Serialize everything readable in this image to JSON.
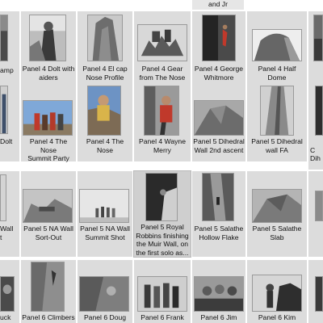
{
  "window": {
    "title": ""
  },
  "rows": [
    {
      "name": "row-1",
      "tiles": [
        {
          "id": "r1c0",
          "label": "amp"
        },
        {
          "id": "r1c1",
          "label": "Panel 4 Dolt with\naiders"
        },
        {
          "id": "r1c2",
          "label": "Panel 4 El cap\nNose Profile"
        },
        {
          "id": "r1c3",
          "label": "Panel 4 Gear\nfrom The Nose"
        },
        {
          "id": "r1c4",
          "label": "Panel 4 George\nWhitmore"
        },
        {
          "id": "r1c5",
          "label": "Panel 4 Half\nDome"
        },
        {
          "id": "r1c6",
          "label": ""
        }
      ]
    },
    {
      "name": "row-2",
      "tiles": [
        {
          "id": "r2c0",
          "label": "Dolt"
        },
        {
          "id": "r2c1",
          "label": "Panel 4 The Nose\nSummit Party"
        },
        {
          "id": "r2c2",
          "label": "Panel 4 The Nose"
        },
        {
          "id": "r2c3",
          "label": "Panel 4 Wayne\nMerry"
        },
        {
          "id": "r2c4",
          "label": "Panel 5 Dihedral\nWall 2nd ascent"
        },
        {
          "id": "r2c5",
          "label": "Panel 5 Dihedral\nwall FA"
        },
        {
          "id": "r2c6",
          "label": "\nC\nDih"
        }
      ]
    },
    {
      "name": "row-3",
      "tiles": [
        {
          "id": "r3c0",
          "label": "Wall\nt"
        },
        {
          "id": "r3c1",
          "label": "Panel 5 NA Wall\nSort-Out"
        },
        {
          "id": "r3c2",
          "label": "Panel 5 NA Wall\nSummit Shot"
        },
        {
          "id": "r3c3",
          "label": "Panel 5 Royal\nRobbins finishing\nthe Muir Wall, on\nthe first solo as..."
        },
        {
          "id": "r3c4",
          "label": "Panel 5 Salathe\nHollow Flake"
        },
        {
          "id": "r3c5",
          "label": "Panel 5 Salathe\nSlab"
        },
        {
          "id": "r3c6",
          "label": ""
        }
      ]
    },
    {
      "name": "row-4",
      "tiles": [
        {
          "id": "r4c0",
          "label": "uck"
        },
        {
          "id": "r4c1",
          "label": "Panel 6 Climbers"
        },
        {
          "id": "r4c2",
          "label": "Panel 6 Doug"
        },
        {
          "id": "r4c3",
          "label": "Panel 6 Frank"
        },
        {
          "id": "r4c4",
          "label": "Panel 6 Jim"
        },
        {
          "id": "r4c5",
          "label": "Panel 6 Kim"
        },
        {
          "id": "r4c6",
          "label": ""
        }
      ]
    }
  ],
  "top_partial": {
    "label": "and Jr"
  }
}
